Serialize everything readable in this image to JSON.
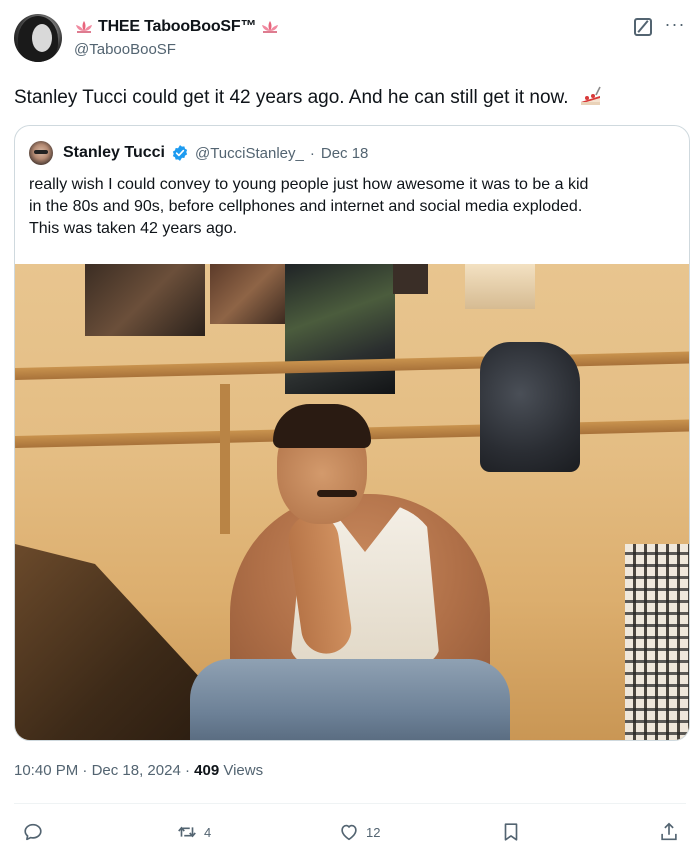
{
  "author": {
    "display_name": "THEE TabooBooSF™",
    "handle": "@TabooBooSF",
    "decoration_icon": "lotus-icon"
  },
  "tweet": {
    "text": "Stanley Tucci could get it 42 years ago. And he can still get it now.",
    "emoji": "pie-slice-emoji"
  },
  "quoted_tweet": {
    "display_name": "Stanley Tucci",
    "verified": true,
    "handle": "@TucciStanley_",
    "separator": "·",
    "date": "Dec 18",
    "text_lines": [
      "really wish I could convey to young people just how awesome it was to be a kid",
      "in the 80s and 90s, before cellphones and internet and social media exploded.",
      "This was taken 42 years ago."
    ]
  },
  "meta": {
    "time": "10:40 PM",
    "separator": "·",
    "date": "Dec 18, 2024",
    "separator2": "·",
    "views_count": "409",
    "views_label": "Views"
  },
  "actions": {
    "reply_count": "",
    "retweet_count": "4",
    "like_count": "12"
  },
  "colors": {
    "text": "#0f1419",
    "secondary": "#536471",
    "border": "#cfd9de",
    "verified": "#1d9bf0",
    "lotus": "#e8647c"
  }
}
